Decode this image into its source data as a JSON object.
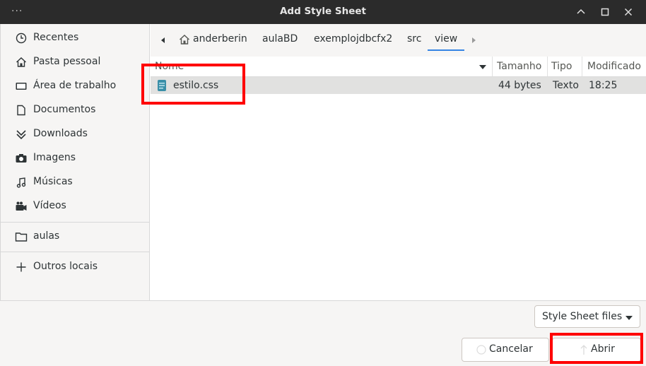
{
  "window": {
    "title": "Add Style Sheet",
    "menu_glyph": "···"
  },
  "sidebar": {
    "items": [
      {
        "label": "Recentes",
        "icon": "clock-icon"
      },
      {
        "label": "Pasta pessoal",
        "icon": "home-icon"
      },
      {
        "label": "Área de trabalho",
        "icon": "desktop-icon"
      },
      {
        "label": "Documentos",
        "icon": "document-icon"
      },
      {
        "label": "Downloads",
        "icon": "download-icon"
      },
      {
        "label": "Imagens",
        "icon": "camera-icon"
      },
      {
        "label": "Músicas",
        "icon": "music-icon"
      },
      {
        "label": "Vídeos",
        "icon": "video-icon"
      }
    ],
    "bookmarks": [
      {
        "label": "aulas",
        "icon": "folder-icon"
      }
    ],
    "other": {
      "label": "Outros locais",
      "icon": "plus-icon"
    }
  },
  "pathbar": {
    "crumbs": [
      "anderberin",
      "aulaBD",
      "exemplojdbcfx2",
      "src",
      "view"
    ],
    "active": "view"
  },
  "columns": {
    "name": "Nome",
    "size": "Tamanho",
    "type": "Tipo",
    "modified": "Modificado"
  },
  "files": [
    {
      "name": "estilo.css",
      "size": "44 bytes",
      "type": "Texto",
      "modified": "18:25",
      "icon": "css-file-icon"
    }
  ],
  "filter": {
    "value": "Style Sheet files"
  },
  "buttons": {
    "cancel": "Cancelar",
    "open": "Abrir"
  },
  "colors": {
    "titlebar": "#2b2b2b",
    "accent": "#3584e4",
    "highlight": "#ff0000",
    "selected_row": "#e1e1e0"
  }
}
